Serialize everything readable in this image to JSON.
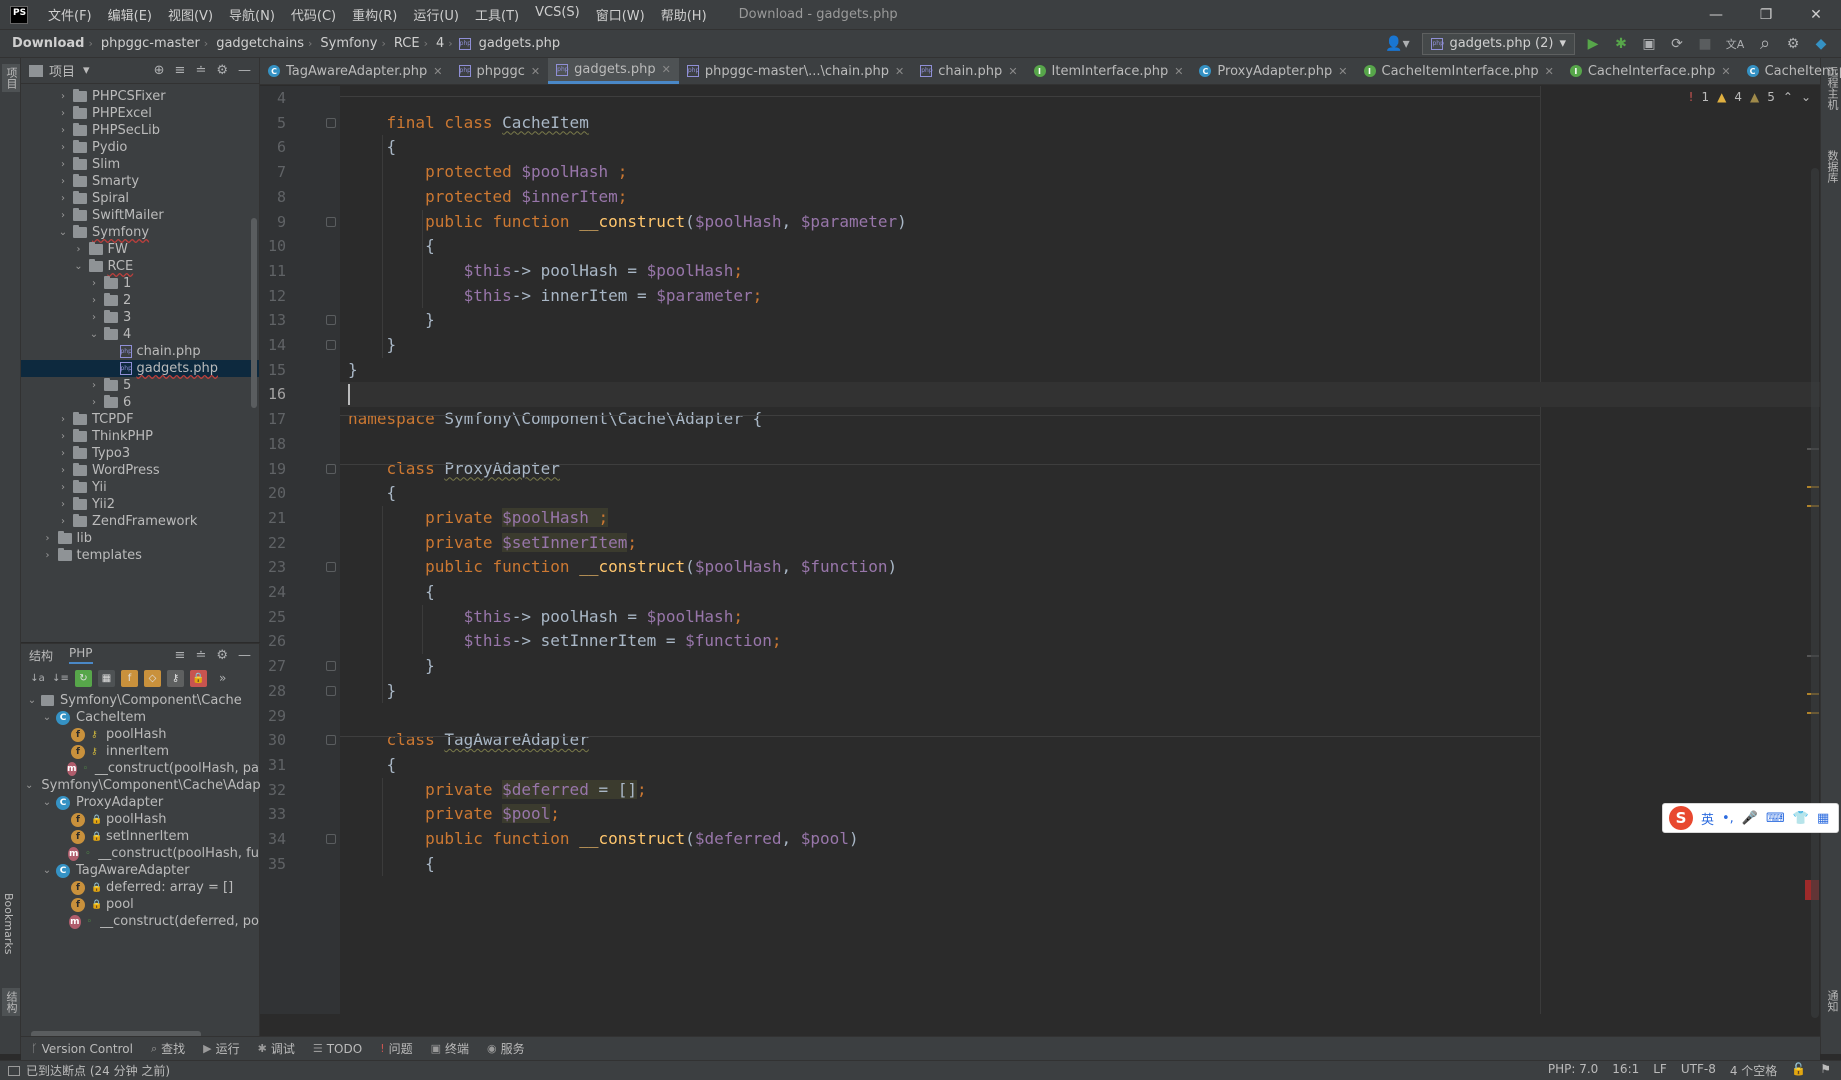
{
  "app": {
    "logo_text": "PS",
    "window_title": "Download - gadgets.php",
    "menu": [
      "文件(F)",
      "编辑(E)",
      "视图(V)",
      "导航(N)",
      "代码(C)",
      "重构(R)",
      "运行(U)",
      "工具(T)",
      "VCS(S)",
      "窗口(W)",
      "帮助(H)"
    ],
    "win_controls": {
      "minimize": "—",
      "restore": "❐",
      "close": "✕"
    }
  },
  "breadcrumb": [
    "Download",
    "phpggc-master",
    "gadgetchains",
    "Symfony",
    "RCE",
    "4",
    "gadgets.php"
  ],
  "run_config": {
    "value": "gadgets.php (2)",
    "arrow": "▾"
  },
  "toolbar_icons": {
    "user": "👤▾",
    "run": "▶",
    "debug": "✱",
    "coverage": "▣",
    "profile": "⟳",
    "stop": "■",
    "translate": "文A",
    "search": "⌕",
    "settings": "⚙",
    "jb": "◆"
  },
  "left_strip": {
    "project": "项目",
    "bookmarks": "Bookmarks",
    "structure": "结构"
  },
  "right_strip": {
    "remote_host": "远程主机",
    "database": "数据库",
    "notifications": "通知"
  },
  "project_panel": {
    "title": "项目",
    "dropdown": "▾",
    "header_icons": {
      "locate": "⊕",
      "expand": "≡",
      "collapse": "≐",
      "settings": "⚙",
      "hide": "—"
    },
    "rows": [
      {
        "label": "PHPCSFixer",
        "type": "folder",
        "depth": 2,
        "arrow": "›",
        "error": false,
        "selected": false
      },
      {
        "label": "PHPExcel",
        "type": "folder",
        "depth": 2,
        "arrow": "›",
        "error": false,
        "selected": false
      },
      {
        "label": "PHPSecLib",
        "type": "folder",
        "depth": 2,
        "arrow": "›",
        "error": false,
        "selected": false
      },
      {
        "label": "Pydio",
        "type": "folder",
        "depth": 2,
        "arrow": "›",
        "error": false,
        "selected": false
      },
      {
        "label": "Slim",
        "type": "folder",
        "depth": 2,
        "arrow": "›",
        "error": false,
        "selected": false
      },
      {
        "label": "Smarty",
        "type": "folder",
        "depth": 2,
        "arrow": "›",
        "error": false,
        "selected": false
      },
      {
        "label": "Spiral",
        "type": "folder",
        "depth": 2,
        "arrow": "›",
        "error": false,
        "selected": false
      },
      {
        "label": "SwiftMailer",
        "type": "folder",
        "depth": 2,
        "arrow": "›",
        "error": false,
        "selected": false
      },
      {
        "label": "Symfony",
        "type": "folder",
        "depth": 2,
        "arrow": "⌄",
        "error": true,
        "selected": false
      },
      {
        "label": "FW",
        "type": "folder",
        "depth": 3,
        "arrow": "›",
        "error": false,
        "selected": false
      },
      {
        "label": "RCE",
        "type": "folder",
        "depth": 3,
        "arrow": "⌄",
        "error": true,
        "selected": false
      },
      {
        "label": "1",
        "type": "folder",
        "depth": 4,
        "arrow": "›",
        "error": false,
        "selected": false
      },
      {
        "label": "2",
        "type": "folder",
        "depth": 4,
        "arrow": "›",
        "error": false,
        "selected": false
      },
      {
        "label": "3",
        "type": "folder",
        "depth": 4,
        "arrow": "›",
        "error": false,
        "selected": false
      },
      {
        "label": "4",
        "type": "folder",
        "depth": 4,
        "arrow": "⌄",
        "error": false,
        "selected": false
      },
      {
        "label": "chain.php",
        "type": "php",
        "depth": 5,
        "arrow": "",
        "error": false,
        "selected": false
      },
      {
        "label": "gadgets.php",
        "type": "php",
        "depth": 5,
        "arrow": "",
        "error": true,
        "selected": true
      },
      {
        "label": "5",
        "type": "folder",
        "depth": 4,
        "arrow": "›",
        "error": false,
        "selected": false
      },
      {
        "label": "6",
        "type": "folder",
        "depth": 4,
        "arrow": "›",
        "error": false,
        "selected": false
      },
      {
        "label": "TCPDF",
        "type": "folder",
        "depth": 2,
        "arrow": "›",
        "error": false,
        "selected": false
      },
      {
        "label": "ThinkPHP",
        "type": "folder",
        "depth": 2,
        "arrow": "›",
        "error": false,
        "selected": false
      },
      {
        "label": "Typo3",
        "type": "folder",
        "depth": 2,
        "arrow": "›",
        "error": false,
        "selected": false
      },
      {
        "label": "WordPress",
        "type": "folder",
        "depth": 2,
        "arrow": "›",
        "error": false,
        "selected": false
      },
      {
        "label": "Yii",
        "type": "folder",
        "depth": 2,
        "arrow": "›",
        "error": false,
        "selected": false
      },
      {
        "label": "Yii2",
        "type": "folder",
        "depth": 2,
        "arrow": "›",
        "error": false,
        "selected": false
      },
      {
        "label": "ZendFramework",
        "type": "folder",
        "depth": 2,
        "arrow": "›",
        "error": false,
        "selected": false
      },
      {
        "label": "lib",
        "type": "folder",
        "depth": 1,
        "arrow": "›",
        "error": false,
        "selected": false
      },
      {
        "label": "templates",
        "type": "folder",
        "depth": 1,
        "arrow": "›",
        "error": false,
        "selected": false
      }
    ]
  },
  "structure_panel": {
    "tabs": [
      "结构",
      "PHP"
    ],
    "header_icons": {
      "expand": "≡",
      "collapse": "≐",
      "settings": "⚙",
      "hide": "—",
      "more": "»"
    },
    "toolbar": [
      "↓a",
      "↓≡",
      "↻",
      "▦",
      "f",
      "◇",
      "⚷",
      "🔒"
    ],
    "rows": [
      {
        "label": "Symfony\\Component\\Cache",
        "icon": "ns",
        "vis": "",
        "depth": 0,
        "arrow": "⌄"
      },
      {
        "label": "CacheItem",
        "icon": "c",
        "vis": "",
        "depth": 1,
        "arrow": "⌄"
      },
      {
        "label": "poolHash",
        "icon": "f",
        "vis": "key",
        "depth": 2,
        "arrow": ""
      },
      {
        "label": "innerItem",
        "icon": "f",
        "vis": "key",
        "depth": 2,
        "arrow": ""
      },
      {
        "label": "__construct(poolHash, pa",
        "icon": "m",
        "vis": "pub",
        "depth": 2,
        "arrow": ""
      },
      {
        "label": "Symfony\\Component\\Cache\\Adap",
        "icon": "ns",
        "vis": "",
        "depth": 0,
        "arrow": "⌄"
      },
      {
        "label": "ProxyAdapter",
        "icon": "c",
        "vis": "",
        "depth": 1,
        "arrow": "⌄"
      },
      {
        "label": "poolHash",
        "icon": "f",
        "vis": "lock",
        "depth": 2,
        "arrow": ""
      },
      {
        "label": "setInnerItem",
        "icon": "f",
        "vis": "lock",
        "depth": 2,
        "arrow": ""
      },
      {
        "label": "__construct(poolHash, fu",
        "icon": "m",
        "vis": "pub",
        "depth": 2,
        "arrow": ""
      },
      {
        "label": "TagAwareAdapter",
        "icon": "c",
        "vis": "",
        "depth": 1,
        "arrow": "⌄"
      },
      {
        "label": "deferred: array = []",
        "icon": "f",
        "vis": "lock",
        "depth": 2,
        "arrow": ""
      },
      {
        "label": "pool",
        "icon": "f",
        "vis": "lock",
        "depth": 2,
        "arrow": ""
      },
      {
        "label": "__construct(deferred, po",
        "icon": "m",
        "vis": "pub",
        "depth": 2,
        "arrow": ""
      }
    ]
  },
  "editor_tabs": [
    {
      "label": "TagAwareAdapter.php",
      "icon": "c",
      "active": false
    },
    {
      "label": "phpggc",
      "icon": "php",
      "active": false
    },
    {
      "label": "gadgets.php",
      "icon": "php",
      "active": true
    },
    {
      "label": "phpggc-master\\...\\chain.php",
      "icon": "php",
      "active": false
    },
    {
      "label": "chain.php",
      "icon": "php",
      "active": false
    },
    {
      "label": "ItemInterface.php",
      "icon": "i",
      "active": false
    },
    {
      "label": "ProxyAdapter.php",
      "icon": "c",
      "active": false
    },
    {
      "label": "CacheItemInterface.php",
      "icon": "i",
      "active": false
    },
    {
      "label": "CacheInterface.php",
      "icon": "i",
      "active": false
    },
    {
      "label": "CacheItem.php",
      "icon": "c",
      "active": false
    }
  ],
  "editor_tabs_more": "⋮",
  "inspections": {
    "errors": "1",
    "warnings": "4",
    "weak_warnings": "5",
    "error_icon": "!",
    "warning_icon": "▲",
    "weak_icon": "▲",
    "up": "⌃",
    "down": "⌄"
  },
  "code": {
    "current_line": 16,
    "lines": [
      {
        "n": "4",
        "tokens": []
      },
      {
        "n": "5",
        "tokens": [
          {
            "t": "    "
          },
          {
            "t": "final ",
            "c": "kw"
          },
          {
            "t": "class ",
            "c": "kw"
          },
          {
            "t": "CacheItem",
            "c": "cls"
          }
        ]
      },
      {
        "n": "6",
        "tokens": [
          {
            "t": "    {"
          }
        ]
      },
      {
        "n": "7",
        "tokens": [
          {
            "t": "        "
          },
          {
            "t": "protected ",
            "c": "kw"
          },
          {
            "t": "$poolHash",
            "c": "var"
          },
          {
            "t": " ;",
            "c": "kw"
          }
        ]
      },
      {
        "n": "8",
        "tokens": [
          {
            "t": "        "
          },
          {
            "t": "protected ",
            "c": "kw"
          },
          {
            "t": "$innerItem",
            "c": "var"
          },
          {
            "t": ";",
            "c": "kw"
          }
        ]
      },
      {
        "n": "9",
        "tokens": [
          {
            "t": "        "
          },
          {
            "t": "public ",
            "c": "kw"
          },
          {
            "t": "function ",
            "c": "kw"
          },
          {
            "t": "__construct",
            "c": "fn"
          },
          {
            "t": "("
          },
          {
            "t": "$poolHash",
            "c": "var"
          },
          {
            "t": ", "
          },
          {
            "t": "$parameter",
            "c": "var"
          },
          {
            "t": ")"
          }
        ]
      },
      {
        "n": "10",
        "tokens": [
          {
            "t": "        {"
          }
        ]
      },
      {
        "n": "11",
        "tokens": [
          {
            "t": "            "
          },
          {
            "t": "$this",
            "c": "var"
          },
          {
            "t": "-> poolHash = "
          },
          {
            "t": "$poolHash",
            "c": "var"
          },
          {
            "t": ";",
            "c": "kw"
          }
        ]
      },
      {
        "n": "12",
        "tokens": [
          {
            "t": "            "
          },
          {
            "t": "$this",
            "c": "var"
          },
          {
            "t": "-> innerItem = "
          },
          {
            "t": "$parameter",
            "c": "var"
          },
          {
            "t": ";",
            "c": "kw"
          }
        ]
      },
      {
        "n": "13",
        "tokens": [
          {
            "t": "        }"
          }
        ]
      },
      {
        "n": "14",
        "tokens": [
          {
            "t": "    }"
          }
        ]
      },
      {
        "n": "15",
        "tokens": [
          {
            "t": "}"
          }
        ]
      },
      {
        "n": "16",
        "tokens": []
      },
      {
        "n": "17",
        "tokens": [
          {
            "t": "namespace ",
            "c": "kw"
          },
          {
            "t": "Symfony\\Component\\Cache\\Adapter {"
          }
        ]
      },
      {
        "n": "18",
        "tokens": []
      },
      {
        "n": "19",
        "tokens": [
          {
            "t": "    "
          },
          {
            "t": "class ",
            "c": "kw"
          },
          {
            "t": "ProxyAdapter",
            "c": "cls"
          }
        ]
      },
      {
        "n": "20",
        "tokens": [
          {
            "t": "    {"
          }
        ]
      },
      {
        "n": "21",
        "tokens": [
          {
            "t": "        "
          },
          {
            "t": "private ",
            "c": "kw"
          },
          {
            "t": "$poolHash",
            "c": "var hl"
          },
          {
            "t": " ;",
            "c": "kw hl"
          }
        ]
      },
      {
        "n": "22",
        "tokens": [
          {
            "t": "        "
          },
          {
            "t": "private ",
            "c": "kw"
          },
          {
            "t": "$setInnerItem",
            "c": "var hl"
          },
          {
            "t": ";",
            "c": "kw"
          }
        ]
      },
      {
        "n": "23",
        "tokens": [
          {
            "t": "        "
          },
          {
            "t": "public ",
            "c": "kw"
          },
          {
            "t": "function ",
            "c": "kw"
          },
          {
            "t": "__construct",
            "c": "fn"
          },
          {
            "t": "("
          },
          {
            "t": "$poolHash",
            "c": "var"
          },
          {
            "t": ", "
          },
          {
            "t": "$function",
            "c": "var"
          },
          {
            "t": ")"
          }
        ]
      },
      {
        "n": "24",
        "tokens": [
          {
            "t": "        {"
          }
        ]
      },
      {
        "n": "25",
        "tokens": [
          {
            "t": "            "
          },
          {
            "t": "$this",
            "c": "var"
          },
          {
            "t": "-> poolHash = "
          },
          {
            "t": "$poolHash",
            "c": "var"
          },
          {
            "t": ";",
            "c": "kw"
          }
        ]
      },
      {
        "n": "26",
        "tokens": [
          {
            "t": "            "
          },
          {
            "t": "$this",
            "c": "var"
          },
          {
            "t": "-> setInnerItem = "
          },
          {
            "t": "$function",
            "c": "var"
          },
          {
            "t": ";",
            "c": "kw"
          }
        ]
      },
      {
        "n": "27",
        "tokens": [
          {
            "t": "        }"
          }
        ]
      },
      {
        "n": "28",
        "tokens": [
          {
            "t": "    }"
          }
        ]
      },
      {
        "n": "29",
        "tokens": []
      },
      {
        "n": "30",
        "tokens": [
          {
            "t": "    "
          },
          {
            "t": "class ",
            "c": "kw"
          },
          {
            "t": "TagAwareAdapter",
            "c": "cls"
          }
        ]
      },
      {
        "n": "31",
        "tokens": [
          {
            "t": "    {"
          }
        ]
      },
      {
        "n": "32",
        "tokens": [
          {
            "t": "        "
          },
          {
            "t": "private ",
            "c": "kw"
          },
          {
            "t": "$deferred",
            "c": "var hl"
          },
          {
            "t": " = []",
            "c": "plain hl"
          },
          {
            "t": ";",
            "c": "kw"
          }
        ]
      },
      {
        "n": "33",
        "tokens": [
          {
            "t": "        "
          },
          {
            "t": "private ",
            "c": "kw"
          },
          {
            "t": "$pool",
            "c": "var hl"
          },
          {
            "t": ";",
            "c": "kw"
          }
        ]
      },
      {
        "n": "34",
        "tokens": [
          {
            "t": "        "
          },
          {
            "t": "public ",
            "c": "kw"
          },
          {
            "t": "function ",
            "c": "kw"
          },
          {
            "t": "__construct",
            "c": "fn"
          },
          {
            "t": "("
          },
          {
            "t": "$deferred",
            "c": "var"
          },
          {
            "t": ", "
          },
          {
            "t": "$pool",
            "c": "var"
          },
          {
            "t": ")"
          }
        ]
      },
      {
        "n": "35",
        "tokens": [
          {
            "t": "        {"
          }
        ]
      }
    ]
  },
  "ime": {
    "logo": "S",
    "lang": "英",
    "punct": "•,",
    "mic": "🎤",
    "keyboard": "⌨",
    "skin": "👕",
    "apps": "▦"
  },
  "bottom_tools": [
    {
      "label": "Version Control",
      "icon": "ᚴ"
    },
    {
      "label": "查找",
      "icon": "⌕"
    },
    {
      "label": "运行",
      "icon": "▶"
    },
    {
      "label": "调试",
      "icon": "✱"
    },
    {
      "label": "TODO",
      "icon": "☰"
    },
    {
      "label": "问题",
      "icon": "!"
    },
    {
      "label": "终端",
      "icon": "▣"
    },
    {
      "label": "服务",
      "icon": "◉"
    }
  ],
  "status": {
    "message": "已到达断点 (24 分钟 之前)",
    "php_version": "PHP: 7.0",
    "position": "16:1",
    "line_sep": "LF",
    "encoding": "UTF-8",
    "indent": "4 个空格",
    "lock": "🔓",
    "events": "⚑"
  }
}
